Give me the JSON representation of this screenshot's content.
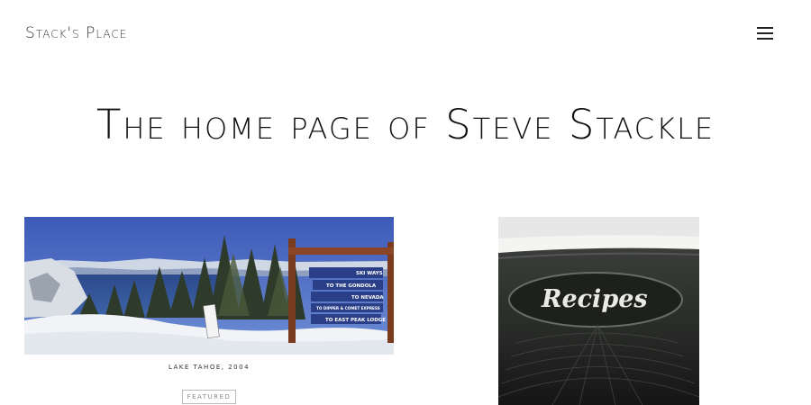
{
  "header": {
    "site_title": "Stack's Place",
    "menu_icon": "hamburger-menu-icon"
  },
  "main": {
    "heading": "The home page of Steve Stackle"
  },
  "posts": [
    {
      "image_alt": "Lake Tahoe ski area sign",
      "caption": "LAKE TAHOE, 2004",
      "badge": "FEATURED",
      "sign_lines": [
        "SKI WAYS",
        "TO THE GONDOLA",
        "TO NEVADA",
        "TO DIPPER & COMET EXPRESS",
        "TO EAST PEAK LODGE"
      ]
    },
    {
      "image_alt": "Recipes box",
      "box_text": "Recipes"
    }
  ]
}
